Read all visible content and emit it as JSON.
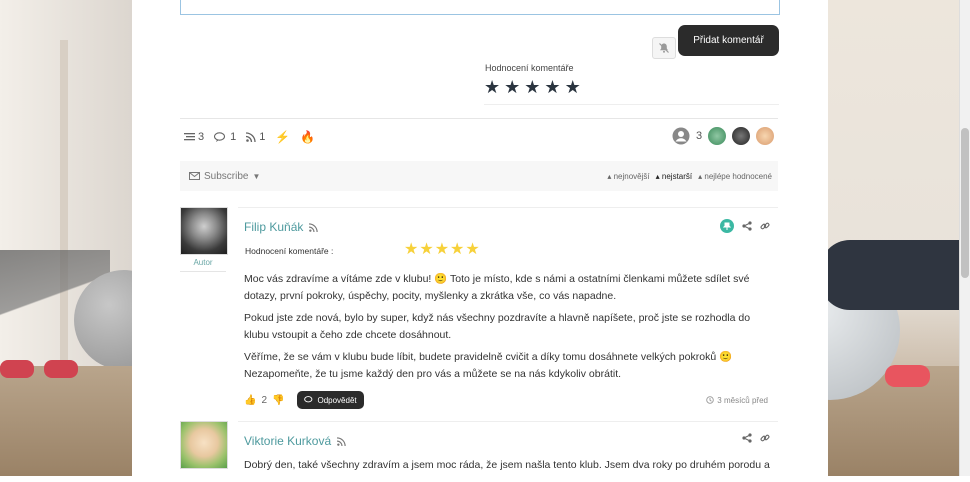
{
  "form": {
    "submit_label": "Přidat komentář",
    "rating_label": "Hodnocení komentáře",
    "rating_stars": 5
  },
  "stats": {
    "threads": "3",
    "comments": "1",
    "rss": "1",
    "online_count": "3"
  },
  "toolbar": {
    "subscribe_label": "Subscribe",
    "sort_newest": "nejnovější",
    "sort_oldest": "nejstarší",
    "sort_top": "nejlépe hodnocené",
    "active_sort": "nejstarší"
  },
  "comments": [
    {
      "author": "Filip Kuňák",
      "role": "Autor",
      "rating_label": "Hodnocení komentáře :",
      "rating": 5,
      "paragraphs": [
        "Moc vás zdravíme a vítáme zde v klubu! 🙂 Toto je místo, kde s námi a ostatními členkami můžete sdílet své dotazy, první pokroky, úspěchy, pocity, myšlenky a zkrátka vše, co vás napadne.",
        "Pokud jste zde nová, bylo by super, když nás všechny pozdravíte a hlavně napíšete, proč jste se rozhodla do klubu vstoupit a čeho zde chcete dosáhnout.",
        "Věříme, že se vám v klubu bude líbit, budete pravidelně cvičit a díky tomu dosáhnete velkých pokroků 🙂 Nezapomeňte, že tu jsme každý den pro vás a můžete se na nás kdykoliv obrátit."
      ],
      "votes": "2",
      "reply_label": "Odpovědět",
      "time": "3 měsíců před"
    },
    {
      "author": "Viktorie Kurková",
      "paragraphs": [
        "Dobrý den, také všechny zdravím a jsem moc ráda, že jsem našla tento klub. Jsem dva roky po druhém porodu a"
      ]
    }
  ],
  "colors": {
    "accent": "#4e9a9e",
    "button_dark": "#2b2b2b",
    "star_yellow": "#f7d13a",
    "star_dark": "#2b3540"
  }
}
